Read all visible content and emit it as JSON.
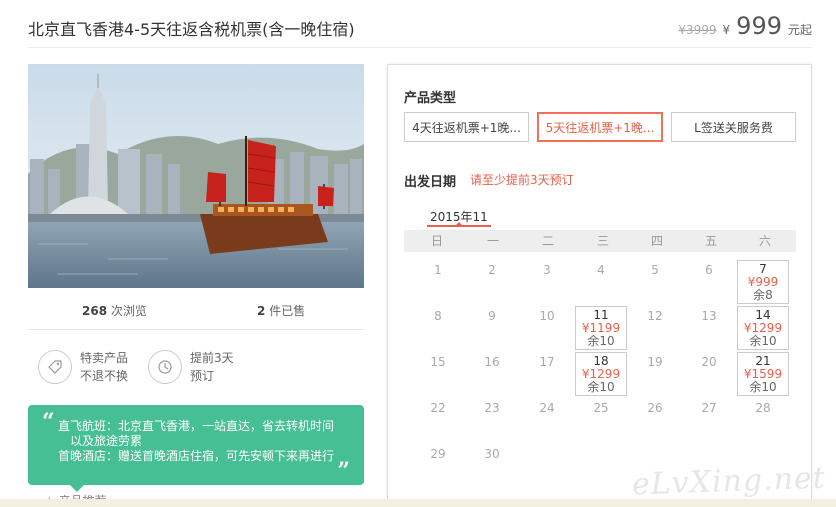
{
  "header": {
    "title": "北京直飞香港4-5天往返含税机票(含一晚住宿)",
    "old_price": "¥3999",
    "currency": "¥",
    "price": "999",
    "suffix": "元起"
  },
  "stats": {
    "views_num": "268",
    "views_label": "次浏览",
    "sold_num": "2",
    "sold_label": "件已售"
  },
  "features": [
    {
      "icon": "tag-icon",
      "line1": "特卖产品",
      "line2": "不退不换"
    },
    {
      "icon": "clock-icon",
      "line1": "提前3天",
      "line2": "预订"
    }
  ],
  "quote": {
    "line1": "直飞航班：北京直飞香港，一站直达，省去转机时间",
    "line2": "以及旅途劳累",
    "line3": "首晚酒店：赠送首晚酒店住宿，可先安顿下来再进行",
    "open_mark": "“",
    "close_mark": "”"
  },
  "more_row": "☆  产品推荐",
  "product_type": {
    "label": "产品类型",
    "options": [
      "4天往返机票+1晚...",
      "5天往返机票+1晚...",
      "L签送关服务费"
    ],
    "selected_index": 1
  },
  "date": {
    "label": "出发日期",
    "hint": "请至少提前3天预订",
    "month": "2015年11",
    "weekdays": [
      "日",
      "一",
      "二",
      "三",
      "四",
      "五",
      "六"
    ],
    "weeks": [
      [
        "1",
        "2",
        "3",
        "4",
        "5",
        "6",
        "7"
      ],
      [
        "8",
        "9",
        "10",
        "11",
        "12",
        "13",
        "14"
      ],
      [
        "15",
        "16",
        "17",
        "18",
        "19",
        "20",
        "21"
      ],
      [
        "22",
        "23",
        "24",
        "25",
        "26",
        "27",
        "28"
      ],
      [
        "29",
        "30",
        "",
        "",
        "",
        "",
        ""
      ]
    ],
    "available": {
      "7": {
        "price": "¥999",
        "stock": "余8"
      },
      "11": {
        "price": "¥1199",
        "stock": "余10"
      },
      "14": {
        "price": "¥1299",
        "stock": "余10"
      },
      "18": {
        "price": "¥1299",
        "stock": "余10"
      },
      "21": {
        "price": "¥1599",
        "stock": "余10"
      }
    }
  },
  "watermark": "eLvXing.net",
  "colors": {
    "accent": "#e8604a",
    "green": "#47bf95"
  }
}
